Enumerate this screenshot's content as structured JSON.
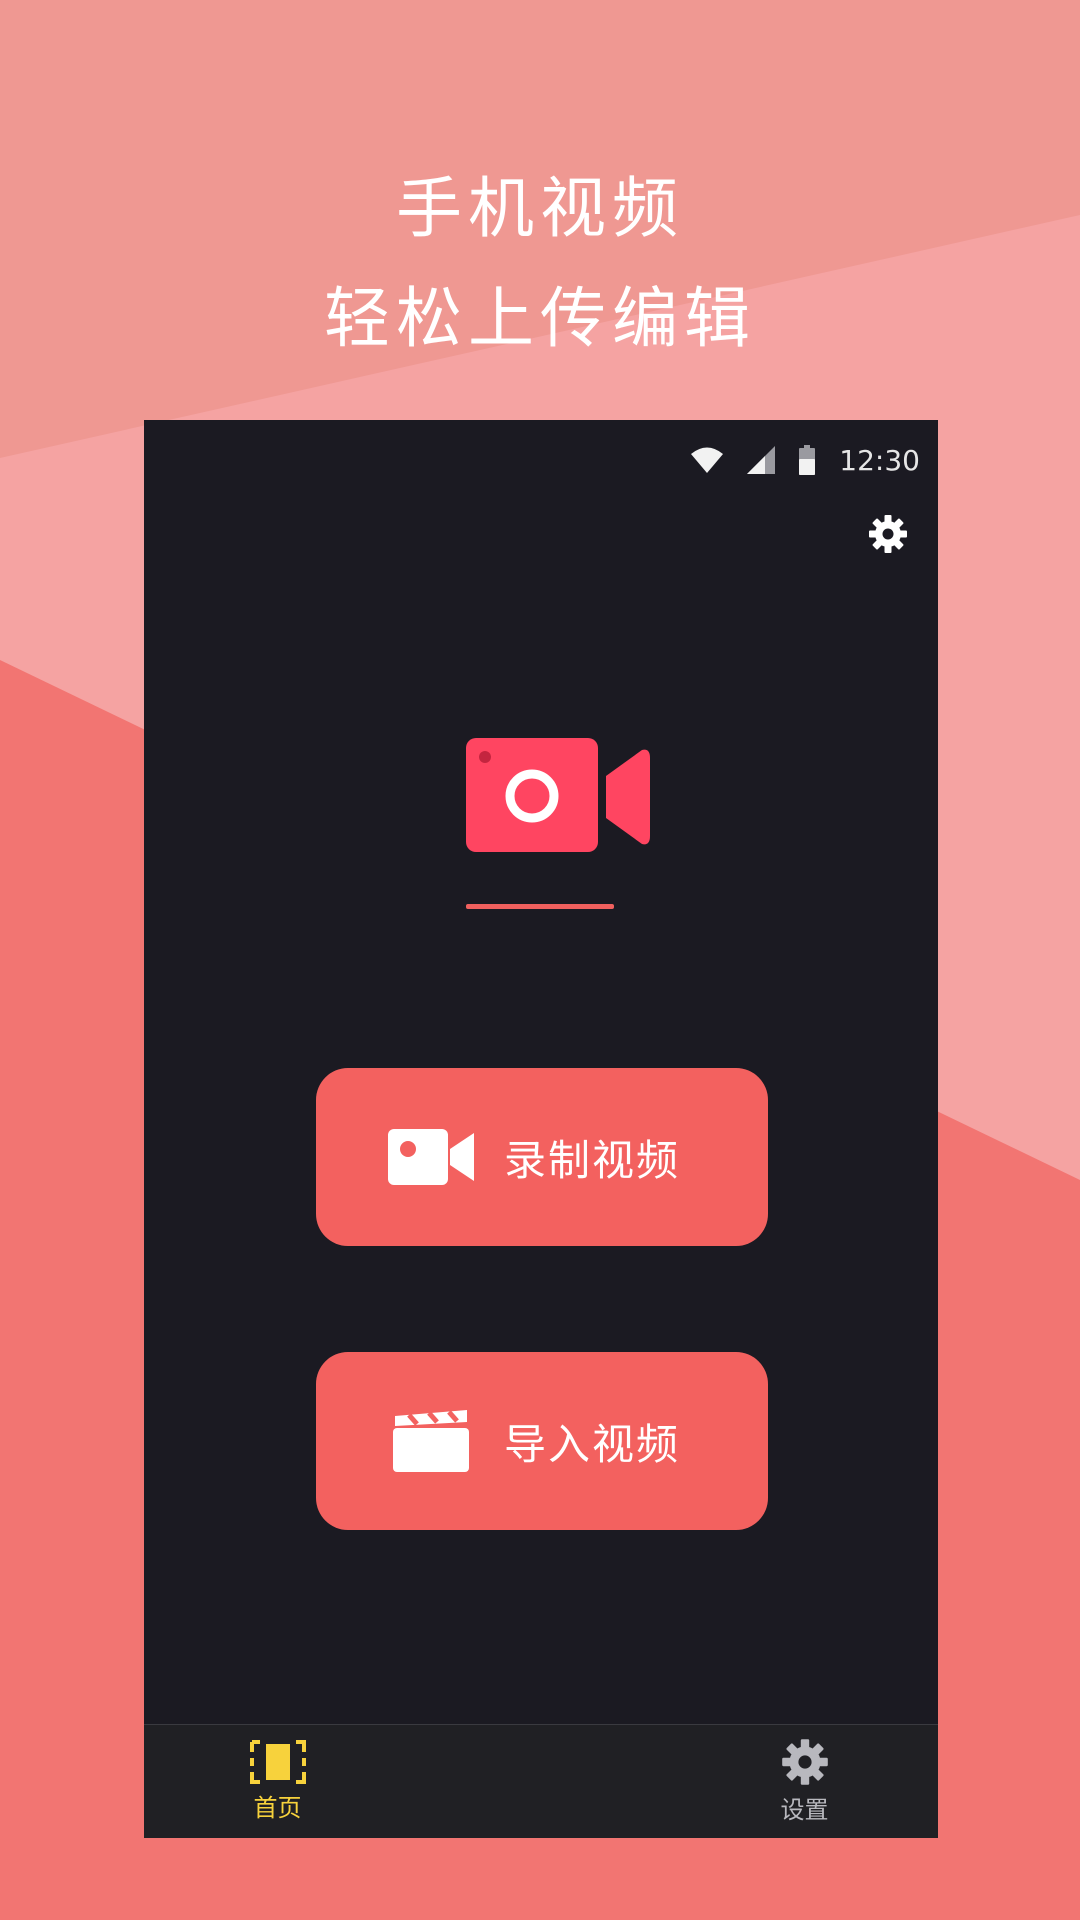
{
  "promo": {
    "line1": "手机视频",
    "line2": "轻松上传编辑"
  },
  "status_bar": {
    "time": "12:30",
    "icons": [
      "wifi-icon",
      "signal-icon",
      "battery-icon"
    ]
  },
  "header": {
    "settings_icon": "gear-icon"
  },
  "logo": {
    "icon": "video-camera-icon",
    "accent_color": "#ff4561"
  },
  "actions": {
    "record": {
      "label": "录制视频",
      "icon": "video-camera-icon"
    },
    "import": {
      "label": "导入视频",
      "icon": "clapperboard-icon"
    }
  },
  "tabs": [
    {
      "label": "首页",
      "icon": "film-frame-icon",
      "active": true,
      "color": "#f7d23c"
    },
    {
      "label": "设置",
      "icon": "gear-icon",
      "active": false,
      "color": "#b8b8be"
    }
  ],
  "colors": {
    "background": "#f27571",
    "phone_bg": "#1b1a22",
    "button": "#f3615f",
    "tabbar": "#202024"
  }
}
